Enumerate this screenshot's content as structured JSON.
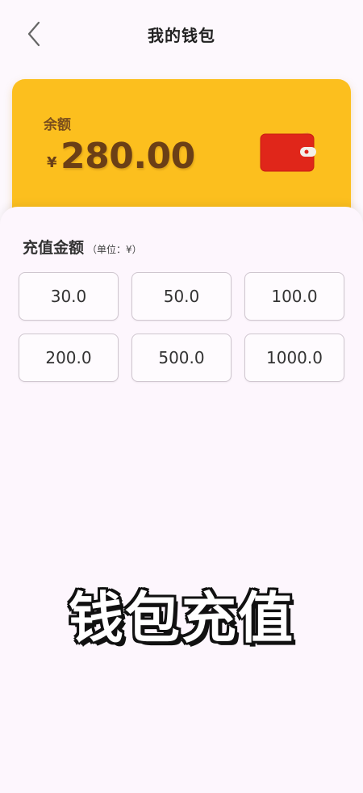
{
  "header": {
    "title": "我的钱包"
  },
  "balance": {
    "label": "余额",
    "currency_symbol": "¥",
    "amount": "280.00",
    "card_color": "#fcbf1e",
    "wallet_color": "#e0261a"
  },
  "recharge": {
    "title": "充值金额",
    "unit": "（单位：¥）",
    "amounts": [
      "30.0",
      "50.0",
      "100.0",
      "200.0",
      "500.0",
      "1000.0"
    ]
  },
  "overlay": {
    "caption": "钱包充值"
  }
}
